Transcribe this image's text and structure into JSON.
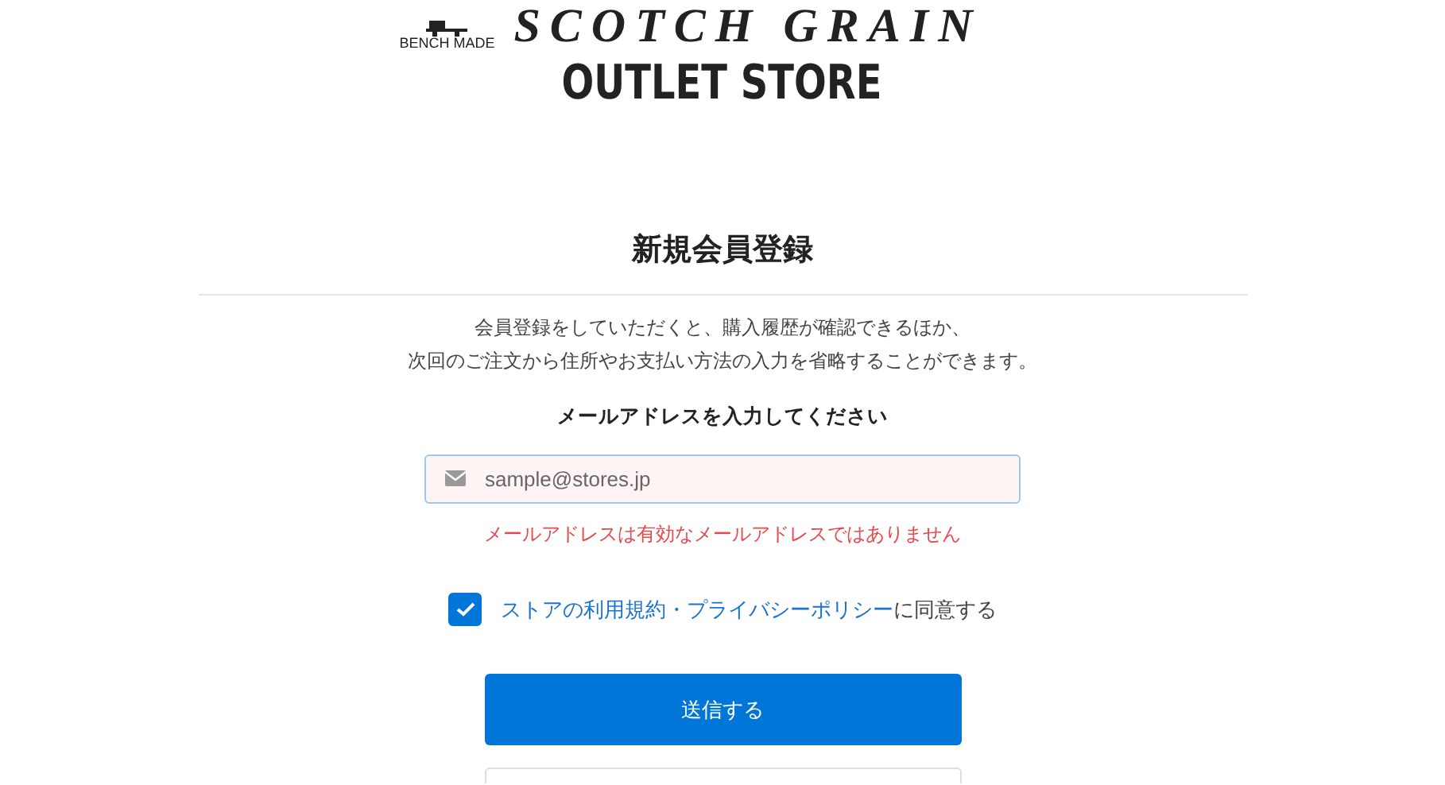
{
  "logo": {
    "badge": "BENCH MADE",
    "brand": "SCOTCH GRAIN",
    "subtitle": "OUTLET STORE"
  },
  "title": "新規会員登録",
  "description": [
    "会員登録をしていただくと、購入履歴が確認できるほか、",
    "次回のご注文から住所やお支払い方法の入力を省略することができます。"
  ],
  "email": {
    "label": "メールアドレスを入力してください",
    "placeholder": "sample@stores.jp",
    "invalid": true,
    "error": "メールアドレスは有効なメールアドレスではありません"
  },
  "agreement": {
    "checked": true,
    "parts": [
      {
        "kind": "link",
        "text": "ストアの利用規約"
      },
      {
        "kind": "link",
        "text": "・"
      },
      {
        "kind": "link",
        "text": "プライバシーポリシー"
      },
      {
        "kind": "text",
        "text": "に同意する"
      }
    ]
  },
  "submit": "送信する"
}
